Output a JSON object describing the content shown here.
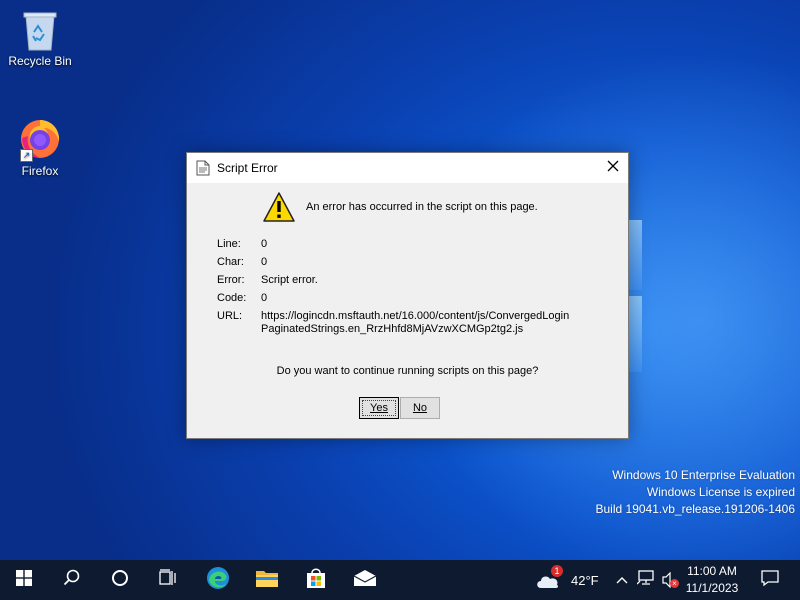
{
  "desktop": {
    "icons": [
      {
        "label": "Recycle Bin",
        "icon": "recycle-bin-icon"
      },
      {
        "label": "Firefox",
        "icon": "firefox-icon"
      }
    ],
    "watermark": {
      "line1": "Windows 10 Enterprise Evaluation",
      "line2": "Windows License is expired",
      "line3": "Build 19041.vb_release.191206-1406"
    }
  },
  "dialog": {
    "title": "Script Error",
    "message": "An error has occurred in the script on this page.",
    "fields": {
      "line_label": "Line:",
      "line_value": "0",
      "char_label": "Char:",
      "char_value": "0",
      "error_label": "Error:",
      "error_value": "Script error.",
      "code_label": "Code:",
      "code_value": "0",
      "url_label": "URL:",
      "url_value": "https://logincdn.msftauth.net/16.000/content/js/ConvergedLoginPaginatedStrings.en_RrzHhfd8MjAVzwXCMGp2tg2.js"
    },
    "question": "Do you want to continue running scripts on this page?",
    "yes_label": "Yes",
    "no_label": "No"
  },
  "taskbar": {
    "apps": [
      "start-icon",
      "search-icon",
      "cortana-icon",
      "task-view-icon",
      "edge-icon",
      "file-explorer-icon",
      "store-icon",
      "mail-icon"
    ],
    "weather": {
      "temperature": "42°F",
      "badge": "1"
    },
    "clock": {
      "time": "11:00 AM",
      "date": "11/1/2023"
    }
  },
  "colors": {
    "accent": "#0a47b7",
    "taskbar": "#0e1a2f",
    "dialog_bg": "#f0f0f0"
  }
}
